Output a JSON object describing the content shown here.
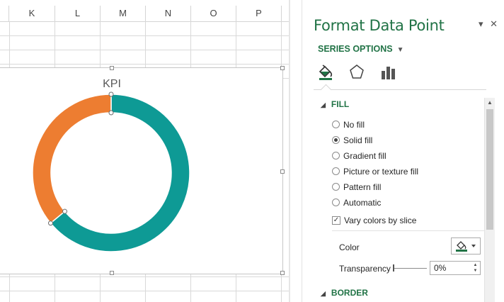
{
  "sheet": {
    "columns": [
      "K",
      "L",
      "M",
      "N",
      "O",
      "P"
    ]
  },
  "chart": {
    "title": "KPI"
  },
  "chart_data": {
    "type": "pie",
    "title": "KPI",
    "categories": [
      "",
      ""
    ],
    "values": [
      64,
      36
    ],
    "colors": [
      "#0e9a95",
      "#ed7d31"
    ],
    "style": "doughnut",
    "legend": "none"
  },
  "pane": {
    "title": "Format Data Point",
    "dropdown_icon": "caret-down-icon",
    "close_icon": "close-icon",
    "series_options_label": "SERIES OPTIONS",
    "tabs": [
      {
        "name": "fill-line-tab",
        "icon": "paint-bucket-icon"
      },
      {
        "name": "effects-tab",
        "icon": "pentagon-icon"
      },
      {
        "name": "series-options-tab",
        "icon": "bar-chart-icon"
      }
    ],
    "fill_section": {
      "header": "FILL",
      "options": [
        "No fill",
        "Solid fill",
        "Gradient fill",
        "Picture or texture fill",
        "Pattern fill",
        "Automatic"
      ],
      "selected": "Solid fill",
      "vary_colors_label": "Vary colors by slice",
      "vary_colors_checked": true,
      "color_label": "Color",
      "transparency_label": "Transparency",
      "transparency_value": "0%"
    },
    "border_section": {
      "header": "BORDER"
    }
  }
}
